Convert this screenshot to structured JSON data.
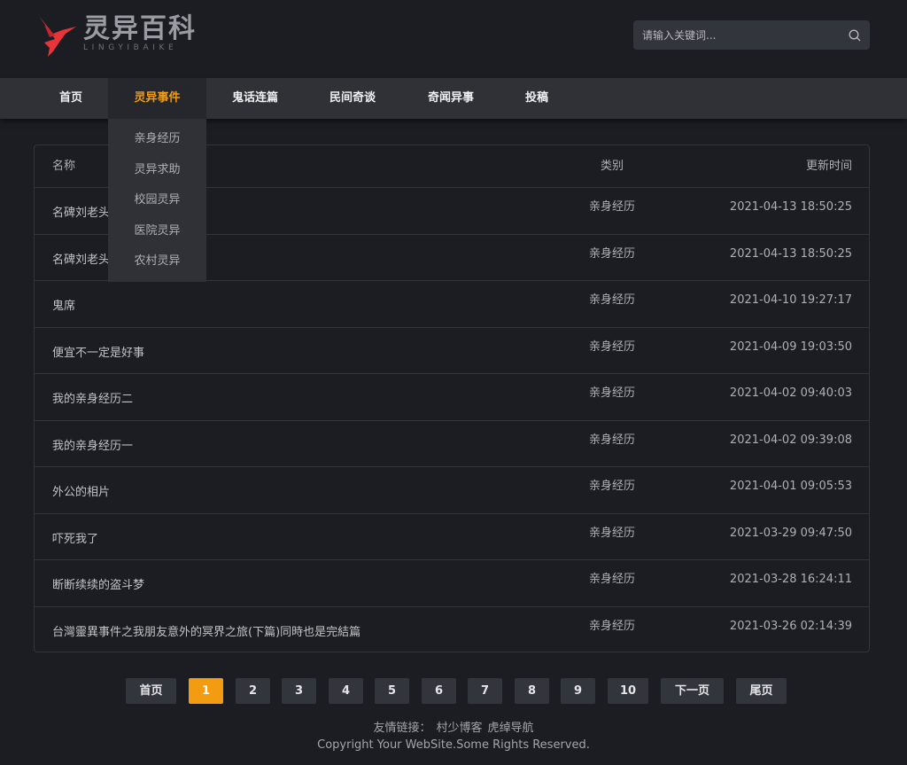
{
  "brand": {
    "name_cn": "灵异百科",
    "name_en": "LINGYIBAIKE",
    "logo_icon": "bird-logo-icon",
    "accent": "#e8353a"
  },
  "search": {
    "placeholder": "请输入关键词...",
    "icon": "search-icon"
  },
  "nav": {
    "items": [
      {
        "label": "首页",
        "active": false
      },
      {
        "label": "灵异事件",
        "active": true
      },
      {
        "label": "鬼话连篇",
        "active": false
      },
      {
        "label": "民间奇谈",
        "active": false
      },
      {
        "label": "奇闻异事",
        "active": false
      },
      {
        "label": "投稿",
        "active": false
      }
    ],
    "active_color": "#f39c12",
    "dropdown": [
      "亲身经历",
      "灵异求助",
      "校园灵异",
      "医院灵异",
      "农村灵异"
    ]
  },
  "table": {
    "headers": {
      "name": "名称",
      "category": "类别",
      "time": "更新时间"
    },
    "rows": [
      {
        "name": "名碑刘老头",
        "category": "亲身经历",
        "time": "2021-04-13 18:50:25"
      },
      {
        "name": "名碑刘老头",
        "category": "亲身经历",
        "time": "2021-04-13 18:50:25"
      },
      {
        "name": "鬼席",
        "category": "亲身经历",
        "time": "2021-04-10 19:27:17"
      },
      {
        "name": "便宜不一定是好事",
        "category": "亲身经历",
        "time": "2021-04-09 19:03:50"
      },
      {
        "name": "我的亲身经历二",
        "category": "亲身经历",
        "time": "2021-04-02 09:40:03"
      },
      {
        "name": "我的亲身经历一",
        "category": "亲身经历",
        "time": "2021-04-02 09:39:08"
      },
      {
        "name": "外公的相片",
        "category": "亲身经历",
        "time": "2021-04-01 09:05:53"
      },
      {
        "name": "吓死我了",
        "category": "亲身经历",
        "time": "2021-03-29 09:47:50"
      },
      {
        "name": "断断续续的盗斗梦",
        "category": "亲身经历",
        "time": "2021-03-28 16:24:11"
      },
      {
        "name": "台灣靈異事件之我朋友意外的冥界之旅(下篇)同時也是完結篇",
        "category": "亲身经历",
        "time": "2021-03-26 02:14:39"
      }
    ]
  },
  "pagination": {
    "first": "首页",
    "pages": [
      "1",
      "2",
      "3",
      "4",
      "5",
      "6",
      "7",
      "8",
      "9",
      "10"
    ],
    "current": "1",
    "next": "下一页",
    "last": "尾页"
  },
  "footer": {
    "links_label": "友情链接：",
    "links": [
      "村少博客",
      "虎绰导航"
    ],
    "copyright": "Copyright Your WebSite.Some Rights Reserved."
  }
}
